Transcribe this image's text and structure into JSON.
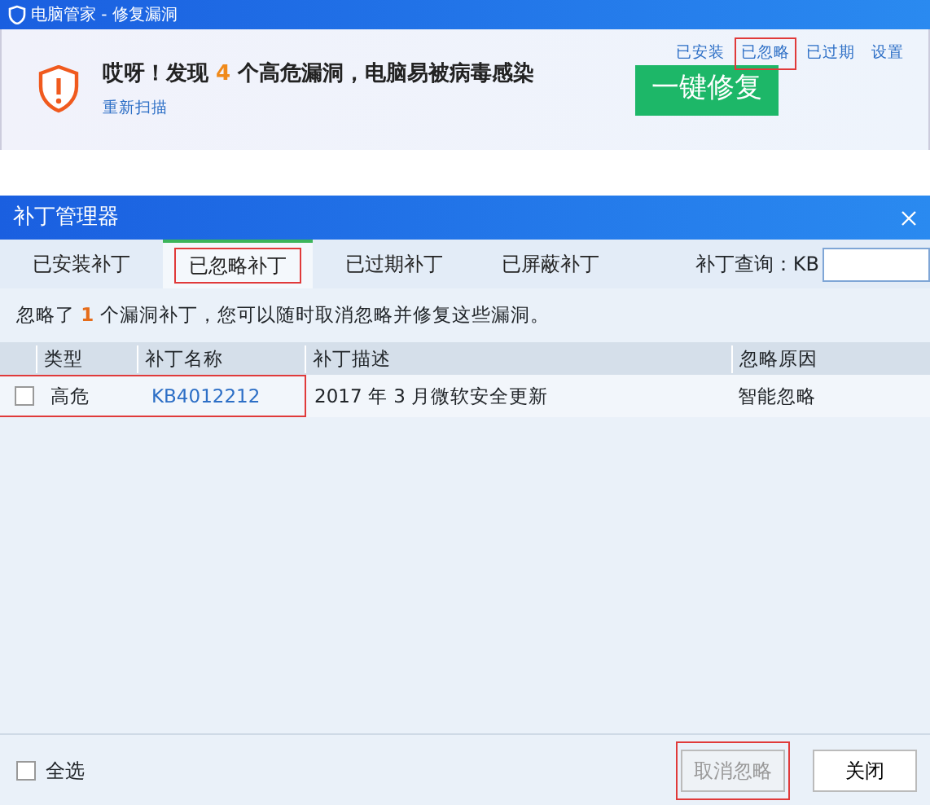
{
  "main_window": {
    "title": "电脑管家 - 修复漏洞",
    "nav_links": [
      {
        "label": "已安装",
        "highlighted": false
      },
      {
        "label": "已忽略",
        "highlighted": true
      },
      {
        "label": "已过期",
        "highlighted": false
      },
      {
        "label": "设置",
        "highlighted": false
      }
    ],
    "alert": {
      "message": "哎呀！发现 **4** 个高危漏洞，电脑易被病毒感染",
      "rescan_link": "重新扫描"
    },
    "fix_button": "一键修复"
  },
  "patch_manager": {
    "title": "补丁管理器",
    "tabs": [
      {
        "label": "已安装补丁",
        "selected": false,
        "highlighted": false
      },
      {
        "label": "已忽略补丁",
        "selected": true,
        "highlighted": true
      },
      {
        "label": "已过期补丁",
        "selected": false,
        "highlighted": false
      },
      {
        "label": "已屏蔽补丁",
        "selected": false,
        "highlighted": false
      }
    ],
    "search": {
      "label": "补丁查询：KB"
    },
    "info": "忽略了 **1** 个漏洞补丁，您可以随时取消忽略并修复这些漏洞。",
    "table": {
      "columns": [
        "类型",
        "补丁名称",
        "补丁描述",
        "忽略原因"
      ],
      "rows": [
        {
          "checked": false,
          "type": "高危",
          "name": "KB4012212",
          "description": "2017 年 3 月微软安全更新",
          "reason": "智能忽略",
          "highlighted": true
        }
      ]
    },
    "select_all": {
      "label": "全选",
      "checked": false
    },
    "buttons": [
      {
        "label": "取消忽略",
        "disabled": true,
        "highlighted": true
      },
      {
        "label": "关闭",
        "disabled": false,
        "highlighted": false
      }
    ]
  }
}
